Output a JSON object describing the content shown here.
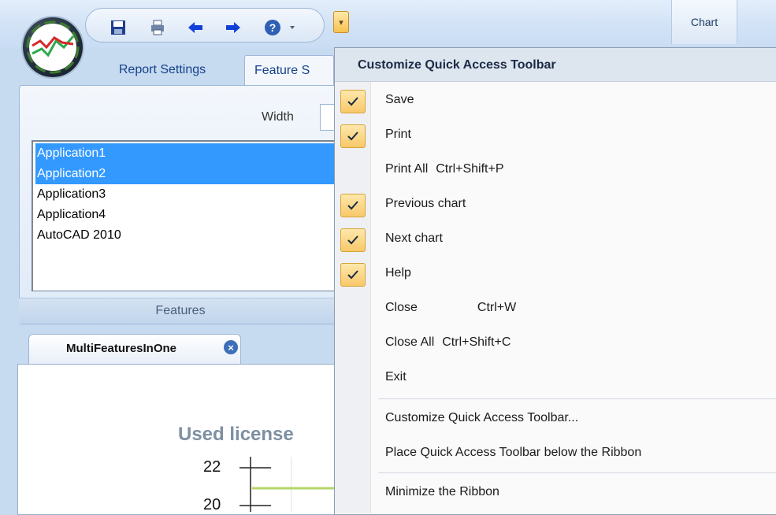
{
  "qat": {
    "icons": [
      "save-icon",
      "print-icon",
      "back-arrow-icon",
      "forward-arrow-icon",
      "help-icon"
    ],
    "dropdown_glyph": "▾"
  },
  "ribbon": {
    "context_tab": "Chart",
    "tabs": [
      "Report Settings",
      "Feature S"
    ],
    "width_label": "Width",
    "features_group_label": "Features",
    "features": [
      {
        "label": "Application1",
        "selected": true
      },
      {
        "label": "Application2",
        "selected": true
      },
      {
        "label": "Application3",
        "selected": false
      },
      {
        "label": "Application4",
        "selected": false
      },
      {
        "label": "AutoCAD 2010",
        "selected": false
      }
    ]
  },
  "document": {
    "tab_label": "MultiFeaturesInOne",
    "chart_title": "Used license",
    "y_ticks": [
      "22",
      "20"
    ]
  },
  "menu": {
    "title": "Customize Quick Access Toolbar",
    "items": [
      {
        "label": "Save",
        "checked": true,
        "shortcut": ""
      },
      {
        "label": "Print",
        "checked": true,
        "shortcut": ""
      },
      {
        "label": "Print All",
        "checked": false,
        "shortcut": "Ctrl+Shift+P"
      },
      {
        "label": "Previous chart",
        "checked": true,
        "shortcut": ""
      },
      {
        "label": "Next chart",
        "checked": true,
        "shortcut": ""
      },
      {
        "label": "Help",
        "checked": true,
        "shortcut": ""
      },
      {
        "label": "Close",
        "checked": false,
        "shortcut": "Ctrl+W"
      },
      {
        "label": "Close All",
        "checked": false,
        "shortcut": "Ctrl+Shift+C"
      },
      {
        "label": "Exit",
        "checked": false,
        "shortcut": ""
      }
    ],
    "customize_label": "Customize Quick Access Toolbar...",
    "place_below_label": "Place Quick Access Toolbar below the Ribbon",
    "minimize_label": "Minimize the Ribbon"
  },
  "colors": {
    "selection": "#3399ff",
    "check_highlight": "#f8c869",
    "chart_line": "#b5d66a"
  }
}
